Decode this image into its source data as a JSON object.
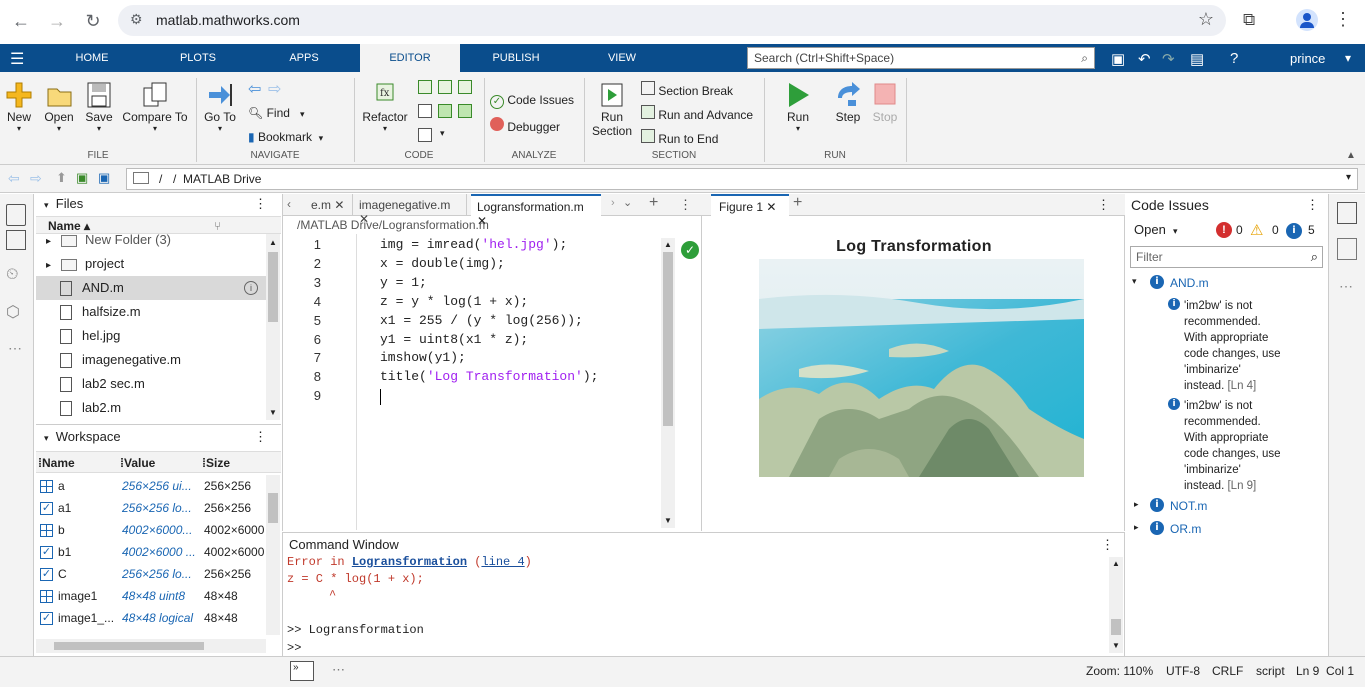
{
  "browser": {
    "url": "matlab.mathworks.com"
  },
  "tabs": [
    "HOME",
    "PLOTS",
    "APPS",
    "EDITOR",
    "PUBLISH",
    "VIEW"
  ],
  "search_placeholder": "Search (Ctrl+Shift+Space)",
  "user": "prince",
  "ribbon": {
    "file": {
      "new": "New",
      "open": "Open",
      "save": "Save",
      "compare": "Compare To",
      "label": "FILE"
    },
    "navigate": {
      "goto": "Go To",
      "find": "Find",
      "bookmark": "Bookmark",
      "label": "NAVIGATE"
    },
    "code": {
      "refactor": "Refactor",
      "label": "CODE"
    },
    "analyze": {
      "code_issues": "Code Issues",
      "debugger": "Debugger",
      "label": "ANALYZE"
    },
    "section": {
      "run_section": "Run\nSection",
      "run_section_1": "Run",
      "run_section_2": "Section",
      "section_break": "Section Break",
      "run_advance": "Run and Advance",
      "run_end": "Run to End",
      "label": "SECTION"
    },
    "run": {
      "run": "Run",
      "step": "Step",
      "stop": "Stop",
      "label": "RUN"
    }
  },
  "address": {
    "root": "/",
    "path": "MATLAB Drive"
  },
  "files": {
    "title": "Files",
    "col_name": "Name",
    "items": [
      {
        "name": "New Folder (3)",
        "type": "folder"
      },
      {
        "name": "project",
        "type": "folder"
      },
      {
        "name": "AND.m",
        "type": "m",
        "selected": true
      },
      {
        "name": "halfsize.m",
        "type": "m"
      },
      {
        "name": "hel.jpg",
        "type": "img"
      },
      {
        "name": "imagenegative.m",
        "type": "m"
      },
      {
        "name": "lab2 sec.m",
        "type": "m"
      },
      {
        "name": "lab2.m",
        "type": "m"
      }
    ]
  },
  "workspace": {
    "title": "Workspace",
    "cols": [
      "Name",
      "Value",
      "Size"
    ],
    "rows": [
      {
        "name": "a",
        "value": "256×256 ui...",
        "size": "256×256",
        "kind": "grid"
      },
      {
        "name": "a1",
        "value": "256×256 lo...",
        "size": "256×256",
        "kind": "check"
      },
      {
        "name": "b",
        "value": "4002×6000...",
        "size": "4002×6000",
        "kind": "grid"
      },
      {
        "name": "b1",
        "value": "4002×6000 ...",
        "size": "4002×6000",
        "kind": "check"
      },
      {
        "name": "C",
        "value": "256×256 lo...",
        "size": "256×256",
        "kind": "check"
      },
      {
        "name": "image1",
        "value": "48×48 uint8",
        "size": "48×48",
        "kind": "grid"
      },
      {
        "name": "image1_...",
        "value": "48×48 logical",
        "size": "48×48",
        "kind": "check"
      }
    ]
  },
  "editor": {
    "tabs": [
      "e.m",
      "imagenegative.m",
      "Logransformation.m"
    ],
    "path": "/MATLAB Drive/Logransformation.m",
    "lines": [
      {
        "n": "1",
        "pre": "img = imread(",
        "str": "'hel.jpg'",
        "post": ");"
      },
      {
        "n": "2",
        "pre": "x = double(img);",
        "str": "",
        "post": ""
      },
      {
        "n": "3",
        "pre": "y = 1;",
        "str": "",
        "post": ""
      },
      {
        "n": "4",
        "pre": "z = y * log(1 + x);",
        "str": "",
        "post": ""
      },
      {
        "n": "5",
        "pre": "x1 = 255 / (y * log(256));",
        "str": "",
        "post": ""
      },
      {
        "n": "6",
        "pre": "y1 = uint8(x1 * z);",
        "str": "",
        "post": ""
      },
      {
        "n": "7",
        "pre": "imshow(y1);",
        "str": "",
        "post": ""
      },
      {
        "n": "8",
        "pre": "title(",
        "str": "'Log Transformation'",
        "post": ");"
      },
      {
        "n": "9",
        "pre": "",
        "str": "",
        "post": ""
      }
    ]
  },
  "figure": {
    "tab": "Figure 1",
    "title": "Log Transformation"
  },
  "command": {
    "title": "Command Window",
    "err_prefix": "Error in ",
    "err_link": "Logransformation",
    "err_line": "line 4",
    "err_code": "z = C * log(1 + x);",
    "caret": "^",
    "prompt1": ">> Logransformation",
    "prompt2": ">>"
  },
  "issues": {
    "title": "Code Issues",
    "open": "Open",
    "err_count": "0",
    "warn_count": "0",
    "info_count": "5",
    "filter": "Filter",
    "groups": [
      {
        "file": "AND.m",
        "msgs": [
          {
            "t1": "'im2bw' is not",
            "t2": "recommended.",
            "t3": "With appropriate",
            "t4": "code changes, use",
            "t5": "'imbinarize'",
            "t6": "instead.",
            "ln": "[Ln 4]"
          },
          {
            "t1": "'im2bw' is not",
            "t2": "recommended.",
            "t3": "With appropriate",
            "t4": "code changes, use",
            "t5": "'imbinarize'",
            "t6": "instead.",
            "ln": "[Ln 9]"
          }
        ]
      },
      {
        "file": "NOT.m"
      },
      {
        "file": "OR.m"
      }
    ]
  },
  "status": {
    "zoom": "Zoom: 110%",
    "enc": "UTF-8",
    "eol": "CRLF",
    "type": "script",
    "pos": "Ln 9  Col 1"
  }
}
